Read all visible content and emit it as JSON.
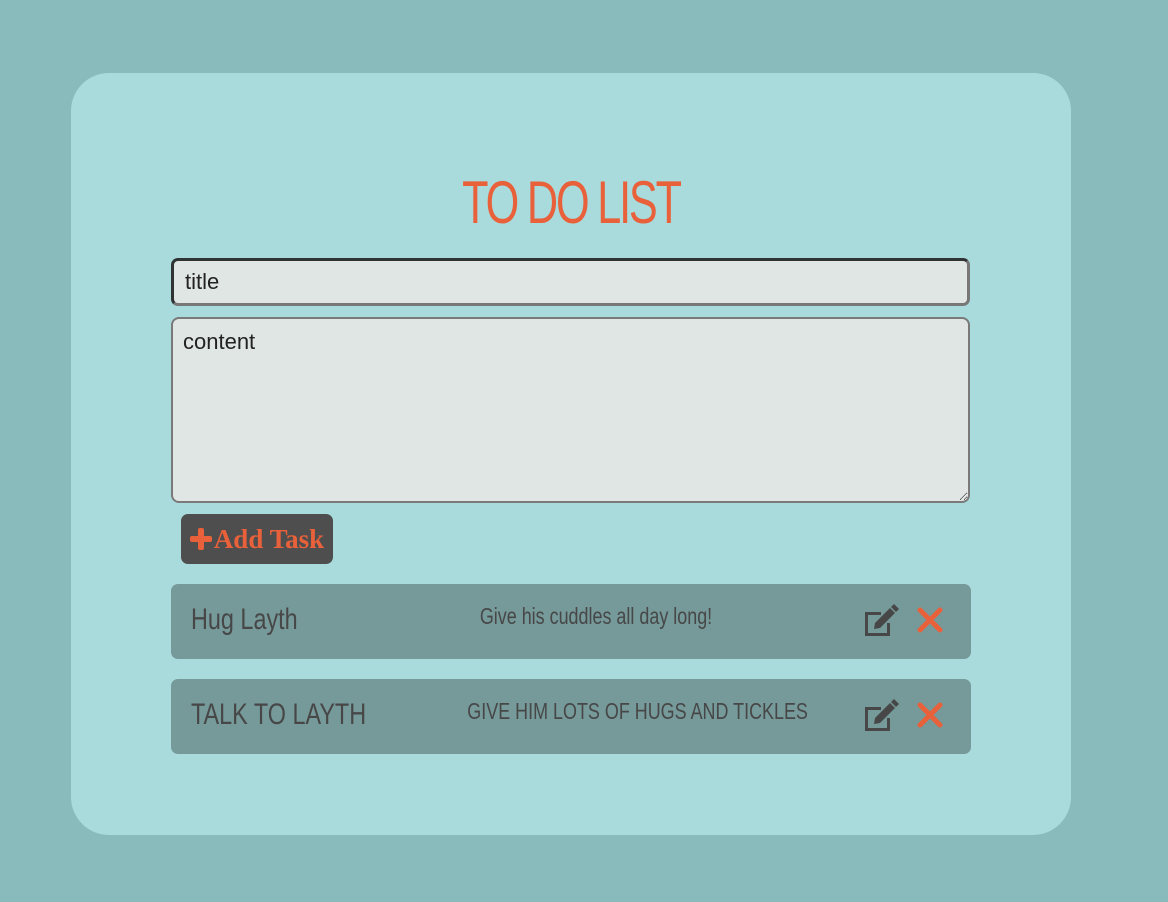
{
  "app": {
    "title": "TO DO LIST"
  },
  "form": {
    "title_value": "title",
    "content_value": "content",
    "add_label": "Add Task"
  },
  "tasks": [
    {
      "title": "Hug Layth",
      "content": "Give his cuddles all day long!"
    },
    {
      "title": "TALK TO LAYTH",
      "content": "GIVE HIM LOTS OF HUGS AND TICKLES"
    }
  ],
  "icons": {
    "add": "plus-icon",
    "edit": "edit-icon",
    "delete": "close-icon"
  },
  "colors": {
    "background": "#89bbbd",
    "card": "#a9dbdc",
    "accent": "#e8613a",
    "task_bg": "#76999a",
    "button_bg": "#4e4e4e"
  }
}
